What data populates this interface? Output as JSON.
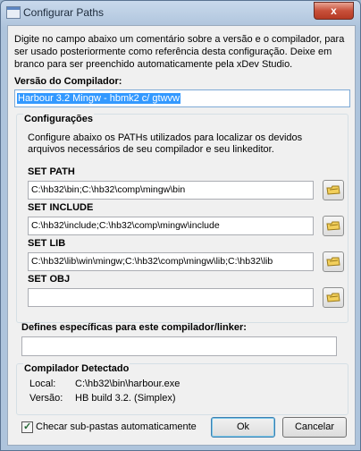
{
  "window": {
    "title": "Configurar Paths",
    "close_label": "x"
  },
  "description": "Digite no campo abaixo um comentário sobre a versão e o compilador, para ser usado posteriormente como referência desta configuração. Deixe em branco para ser preenchido automaticamente pela xDev Studio.",
  "compiler": {
    "label": "Versão do Compilador:",
    "value": "Harbour 3.2 Mingw - hbmk2 c/ gtwvw"
  },
  "configuracoes": {
    "title": "Configurações",
    "description": "Configure abaixo os PATHs utilizados para localizar os devidos arquivos necessários de seu compilador e seu linkeditor.",
    "paths": [
      {
        "label": "SET PATH",
        "value": "C:\\hb32\\bin;C:\\hb32\\comp\\mingw\\bin"
      },
      {
        "label": "SET INCLUDE",
        "value": "C:\\hb32\\include;C:\\hb32\\comp\\mingw\\include"
      },
      {
        "label": "SET LIB",
        "value": "C:\\hb32\\lib\\win\\mingw;C:\\hb32\\comp\\mingw\\lib;C:\\hb32\\lib"
      },
      {
        "label": "SET OBJ",
        "value": ""
      }
    ]
  },
  "defines": {
    "label": "Defines específicas para este compilador/linker:",
    "value": ""
  },
  "detected": {
    "title": "Compilador Detectado",
    "local_label": "Local:",
    "local_value": "C:\\hb32\\bin\\harbour.exe",
    "version_label": "Versão:",
    "version_value": "HB build 3.2. (Simplex)"
  },
  "checkbox": {
    "label": "Checar sub-pastas automaticamente",
    "checked": true
  },
  "buttons": {
    "ok": "Ok",
    "cancel": "Cancelar"
  },
  "icons": {
    "folder_button": "folder-hand-icon",
    "window": "window-icon",
    "close": "close-icon"
  }
}
